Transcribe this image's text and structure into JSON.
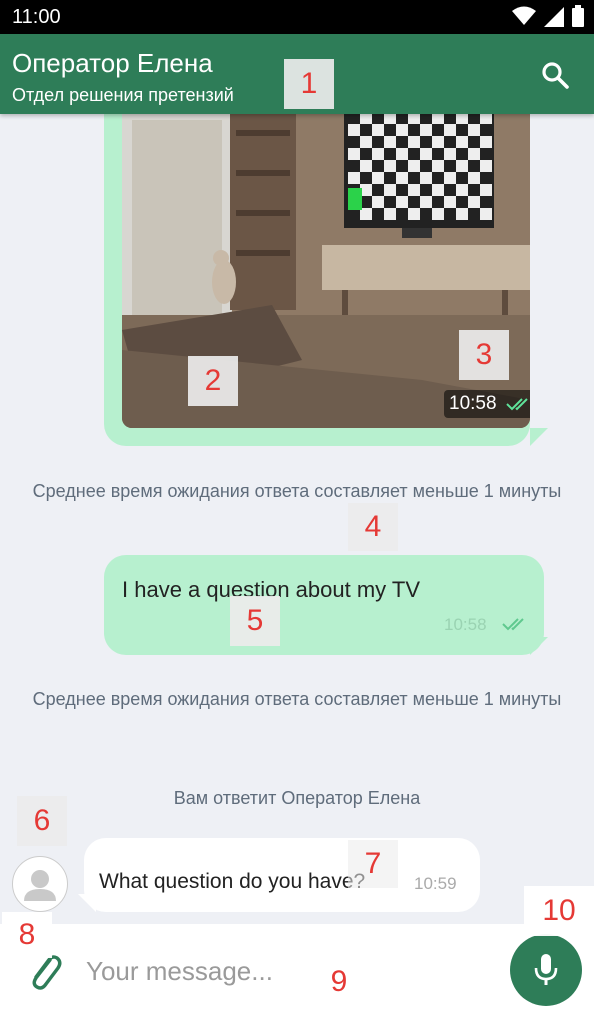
{
  "status_bar": {
    "time": "11:00"
  },
  "header": {
    "title": "Оператор Елена",
    "subtitle": "Отдел решения претензий"
  },
  "messages": {
    "image_time": "10:58",
    "system_1": "Среднее время ожидания ответа составляет меньше 1 минуты",
    "outgoing_text": "I have a question about my TV",
    "outgoing_time": "10:58",
    "system_2": "Среднее время ожидания ответа составляет меньше 1 минуты",
    "system_3": "Вам ответит Оператор Елена",
    "incoming_text": "What question do you have?",
    "incoming_time": "10:59"
  },
  "input": {
    "placeholder": "Your message..."
  },
  "annotations": [
    "1",
    "2",
    "3",
    "4",
    "5",
    "6",
    "7",
    "8",
    "9",
    "10"
  ],
  "colors": {
    "primary": "#2e7d58",
    "bubble_out": "#b7f0cf",
    "background": "#eef0f5",
    "marker_text": "#e53935"
  },
  "icons": [
    "wifi-icon",
    "signal-icon",
    "battery-icon",
    "search-icon",
    "double-check-icon",
    "avatar-icon",
    "paperclip-icon",
    "mic-icon"
  ]
}
